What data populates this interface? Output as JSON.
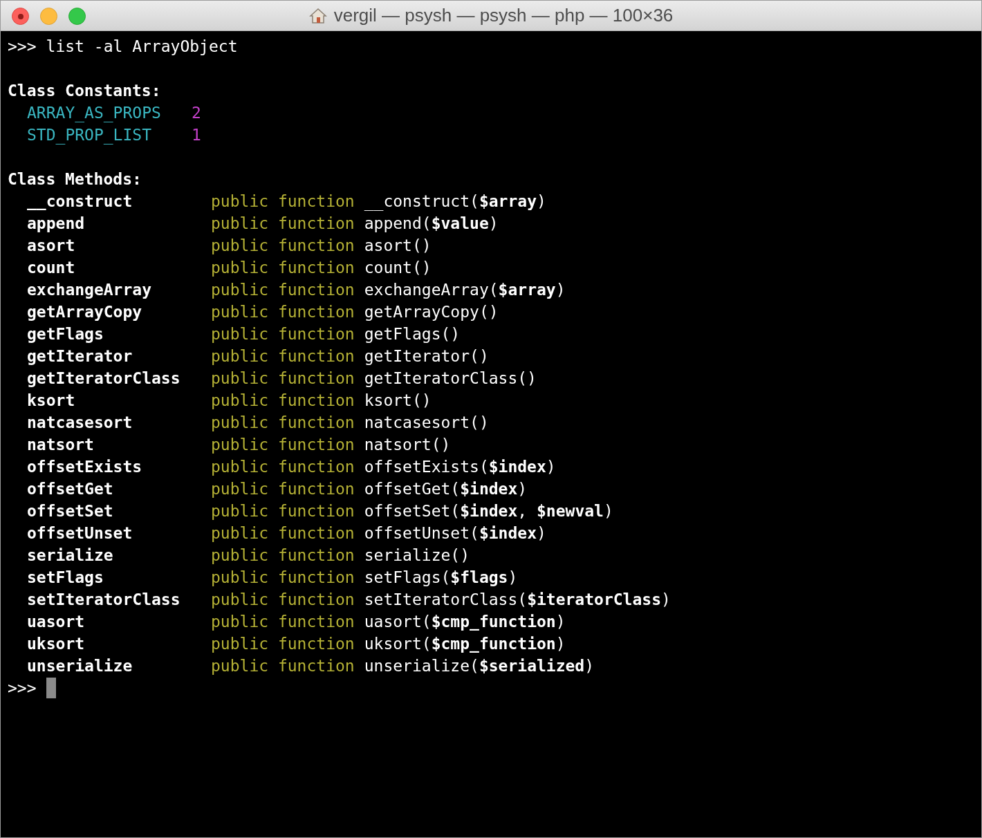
{
  "window": {
    "title": "vergil — psysh — psysh — php — 100×36"
  },
  "terminal": {
    "command_prompt": ">>>",
    "command": "list -al ArrayObject",
    "constants_heading": "Class Constants:",
    "constants": [
      {
        "name": "ARRAY_AS_PROPS",
        "value": "2"
      },
      {
        "name": "STD_PROP_LIST",
        "value": "1"
      }
    ],
    "methods_heading": "Class Methods:",
    "methods": [
      {
        "name": "__construct",
        "modifiers": "public function",
        "signature": "__construct(**$array**)"
      },
      {
        "name": "append",
        "modifiers": "public function",
        "signature": "append(**$value**)"
      },
      {
        "name": "asort",
        "modifiers": "public function",
        "signature": "asort()"
      },
      {
        "name": "count",
        "modifiers": "public function",
        "signature": "count()"
      },
      {
        "name": "exchangeArray",
        "modifiers": "public function",
        "signature": "exchangeArray(**$array**)"
      },
      {
        "name": "getArrayCopy",
        "modifiers": "public function",
        "signature": "getArrayCopy()"
      },
      {
        "name": "getFlags",
        "modifiers": "public function",
        "signature": "getFlags()"
      },
      {
        "name": "getIterator",
        "modifiers": "public function",
        "signature": "getIterator()"
      },
      {
        "name": "getIteratorClass",
        "modifiers": "public function",
        "signature": "getIteratorClass()"
      },
      {
        "name": "ksort",
        "modifiers": "public function",
        "signature": "ksort()"
      },
      {
        "name": "natcasesort",
        "modifiers": "public function",
        "signature": "natcasesort()"
      },
      {
        "name": "natsort",
        "modifiers": "public function",
        "signature": "natsort()"
      },
      {
        "name": "offsetExists",
        "modifiers": "public function",
        "signature": "offsetExists(**$index**)"
      },
      {
        "name": "offsetGet",
        "modifiers": "public function",
        "signature": "offsetGet(**$index**)"
      },
      {
        "name": "offsetSet",
        "modifiers": "public function",
        "signature": "offsetSet(**$index**, **$newval**)"
      },
      {
        "name": "offsetUnset",
        "modifiers": "public function",
        "signature": "offsetUnset(**$index**)"
      },
      {
        "name": "serialize",
        "modifiers": "public function",
        "signature": "serialize()"
      },
      {
        "name": "setFlags",
        "modifiers": "public function",
        "signature": "setFlags(**$flags**)"
      },
      {
        "name": "setIteratorClass",
        "modifiers": "public function",
        "signature": "setIteratorClass(**$iteratorClass**)"
      },
      {
        "name": "uasort",
        "modifiers": "public function",
        "signature": "uasort(**$cmp_function**)"
      },
      {
        "name": "uksort",
        "modifiers": "public function",
        "signature": "uksort(**$cmp_function**)"
      },
      {
        "name": "unserialize",
        "modifiers": "public function",
        "signature": "unserialize(**$serialized**)"
      }
    ],
    "input_prompt": ">>>"
  }
}
